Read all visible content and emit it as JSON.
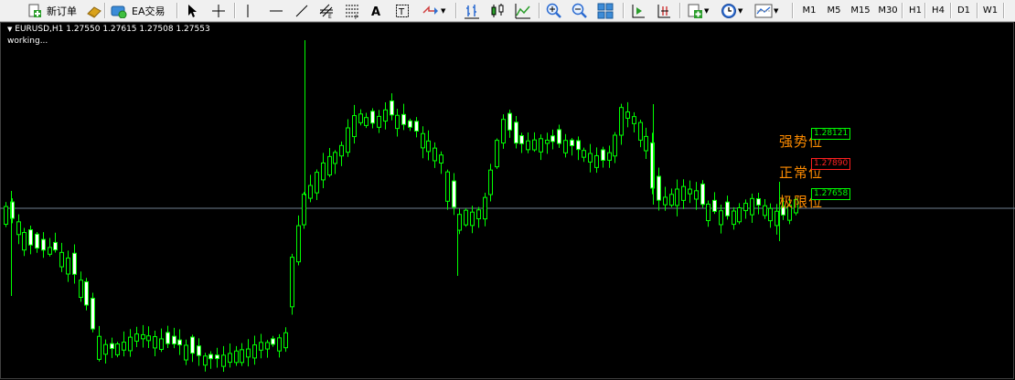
{
  "toolbar": {
    "new_order": "新订单",
    "ea_trading": "EA交易",
    "timeframes": [
      "M1",
      "M5",
      "M15",
      "M30",
      "H1",
      "H4",
      "D1",
      "W1"
    ]
  },
  "chart": {
    "symbol_line": "EURUSD,H1  1.27550 1.27615 1.27508 1.27553",
    "status": "working...",
    "colors": {
      "background": "#000000",
      "candle": "#00ff00",
      "horizontal_line": "#708090"
    },
    "levels": [
      {
        "label": "强势位",
        "price": "1.28121",
        "color": "#00ff00"
      },
      {
        "label": "正常位",
        "price": "1.27890",
        "color": "#ff2020"
      },
      {
        "label": "极限位",
        "price": "1.27658",
        "color": "#00ff00"
      }
    ]
  }
}
